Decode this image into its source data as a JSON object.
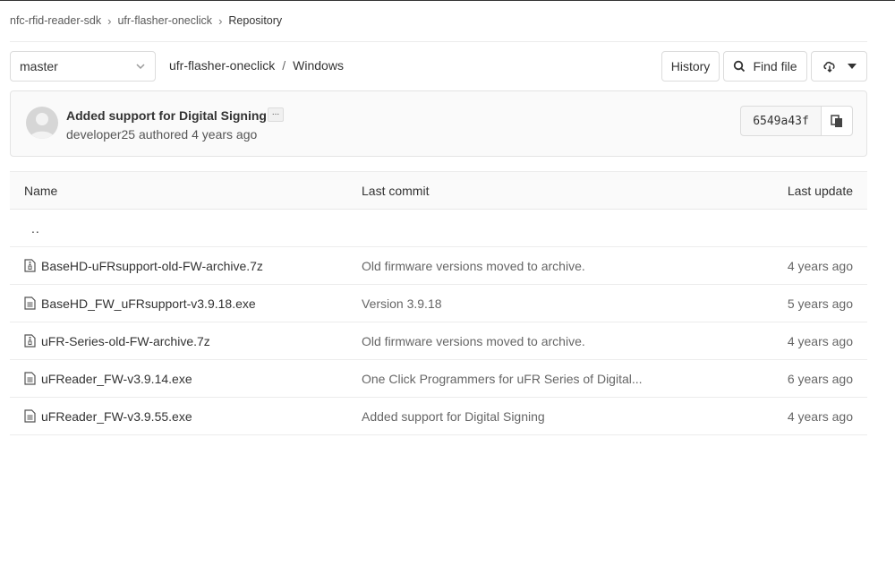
{
  "breadcrumb": {
    "items": [
      "nfc-rfid-reader-sdk",
      "ufr-flasher-oneclick",
      "Repository"
    ]
  },
  "toolbar": {
    "branch": "master",
    "path": [
      "ufr-flasher-oneclick",
      "Windows"
    ],
    "path_separator": "/",
    "history_label": "History",
    "find_file_label": "Find file"
  },
  "commit": {
    "title": "Added support for Digital Signing",
    "ellipsis": "...",
    "author": "developer25",
    "authored_text": "authored 4 years ago",
    "sha": "6549a43f"
  },
  "table": {
    "headers": {
      "name": "Name",
      "last_commit": "Last commit",
      "last_update": "Last update"
    },
    "parent": "..",
    "rows": [
      {
        "name": "BaseHD-uFRsupport-old-FW-archive.7z",
        "icon": "archive-file-icon",
        "commit": "Old firmware versions moved to archive.",
        "updated": "4 years ago"
      },
      {
        "name": "BaseHD_FW_uFRsupport-v3.9.18.exe",
        "icon": "file-icon",
        "commit": "Version 3.9.18",
        "updated": "5 years ago"
      },
      {
        "name": "uFR-Series-old-FW-archive.7z",
        "icon": "archive-file-icon",
        "commit": "Old firmware versions moved to archive.",
        "updated": "4 years ago"
      },
      {
        "name": "uFReader_FW-v3.9.14.exe",
        "icon": "file-icon",
        "commit": "One Click Programmers for uFR Series of Digital...",
        "updated": "6 years ago"
      },
      {
        "name": "uFReader_FW-v3.9.55.exe",
        "icon": "file-icon",
        "commit": "Added support for Digital Signing",
        "updated": "4 years ago"
      }
    ]
  }
}
